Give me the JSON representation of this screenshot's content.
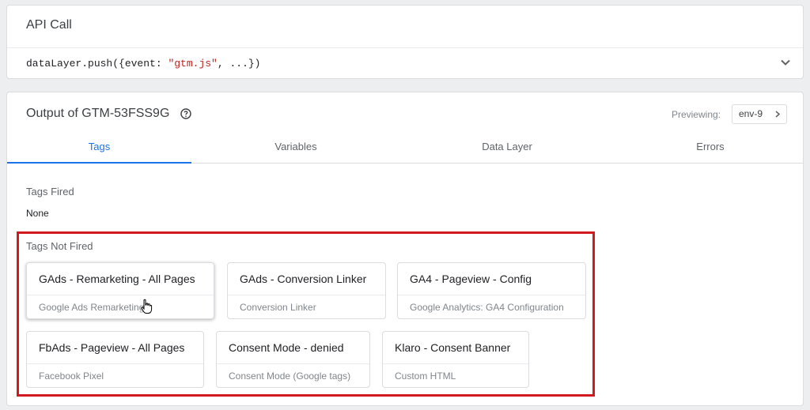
{
  "api_call": {
    "title": "API Call",
    "code_prefix": "dataLayer.push({event: ",
    "code_string": "\"gtm.js\"",
    "code_suffix": ", ...})"
  },
  "output": {
    "title": "Output of GTM-53FSS9G",
    "previewing_label": "Previewing:",
    "env_value": "env-9",
    "tabs": [
      {
        "label": "Tags",
        "active": true
      },
      {
        "label": "Variables",
        "active": false
      },
      {
        "label": "Data Layer",
        "active": false
      },
      {
        "label": "Errors",
        "active": false
      }
    ],
    "tags_fired": {
      "heading": "Tags Fired",
      "empty_text": "None"
    },
    "tags_not_fired": {
      "heading": "Tags Not Fired",
      "items": [
        {
          "name": "GAds - Remarketing - All Pages",
          "type": "Google Ads Remarketing"
        },
        {
          "name": "GAds - Conversion Linker",
          "type": "Conversion Linker"
        },
        {
          "name": "GA4 - Pageview - Config",
          "type": "Google Analytics: GA4 Configuration"
        },
        {
          "name": "FbAds - Pageview - All Pages",
          "type": "Facebook Pixel"
        },
        {
          "name": "Consent Mode - denied",
          "type": "Consent Mode (Google tags)"
        },
        {
          "name": "Klaro - Consent Banner",
          "type": "Custom HTML"
        }
      ]
    }
  },
  "colors": {
    "accent": "#1a73e8",
    "highlight_border": "#d31920"
  }
}
